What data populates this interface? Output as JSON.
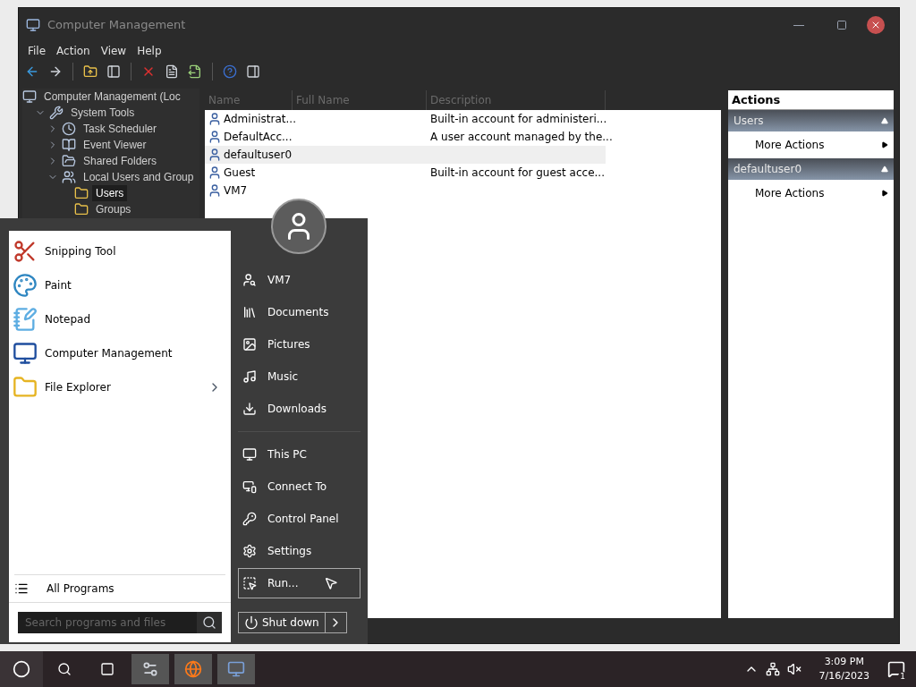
{
  "window": {
    "title": "Computer Management"
  },
  "menu": [
    "File",
    "Action",
    "View",
    "Help"
  ],
  "tree": [
    {
      "label": "Computer Management (Loc",
      "selected": false,
      "children": [
        {
          "label": "System Tools",
          "expanded": true,
          "selected": false,
          "children": [
            {
              "label": "Task Scheduler",
              "expanded": false,
              "selected": false
            },
            {
              "label": "Event Viewer",
              "expanded": false,
              "selected": false
            },
            {
              "label": "Shared Folders",
              "expanded": false,
              "selected": false
            },
            {
              "label": "Local Users and Group",
              "expanded": true,
              "selected": false,
              "children": [
                {
                  "label": "Users",
                  "selected": true
                },
                {
                  "label": "Groups",
                  "selected": false
                }
              ]
            }
          ]
        }
      ]
    }
  ],
  "table": {
    "columns": [
      "Name",
      "Full Name",
      "Description"
    ],
    "rows": [
      {
        "name": "Administrat...",
        "full_name": "",
        "description": "Built-in account for administeri...",
        "selected": false
      },
      {
        "name": "DefaultAcc...",
        "full_name": "",
        "description": "A user account managed by the...",
        "selected": false
      },
      {
        "name": "defaultuser0",
        "full_name": "",
        "description": "",
        "selected": true
      },
      {
        "name": "Guest",
        "full_name": "",
        "description": "Built-in account for guest acce...",
        "selected": false
      },
      {
        "name": "VM7",
        "full_name": "",
        "description": "",
        "selected": false
      }
    ]
  },
  "actions": {
    "title": "Actions",
    "sections": [
      {
        "title": "Users",
        "items": [
          "More Actions"
        ]
      },
      {
        "title": "defaultuser0",
        "items": [
          "More Actions"
        ]
      }
    ]
  },
  "start_menu": {
    "pinned": [
      {
        "label": "Snipping Tool",
        "submenu": false
      },
      {
        "label": "Paint",
        "submenu": false
      },
      {
        "label": "Notepad",
        "submenu": false
      },
      {
        "label": "Computer Management",
        "submenu": false
      },
      {
        "label": "File Explorer",
        "submenu": true
      }
    ],
    "all_programs": "All Programs",
    "search": {
      "placeholder": "Search programs and files"
    },
    "places": [
      [
        {
          "label": "VM7",
          "hovered": false
        },
        {
          "label": "Documents",
          "hovered": false
        },
        {
          "label": "Pictures",
          "hovered": false
        },
        {
          "label": "Music",
          "hovered": false
        },
        {
          "label": "Downloads",
          "hovered": false
        }
      ],
      [
        {
          "label": "This PC",
          "hovered": false
        },
        {
          "label": "Connect To",
          "hovered": false
        },
        {
          "label": "Control Panel",
          "hovered": false
        },
        {
          "label": "Settings",
          "hovered": false
        },
        {
          "label": "Run...",
          "hovered": true
        }
      ]
    ],
    "shutdown": "Shut down"
  },
  "taskbar": {
    "apps": [
      {
        "selected": true
      },
      {
        "selected": true
      },
      {
        "selected": true
      }
    ],
    "time": "3:09 PM",
    "date": "7/16/2023",
    "notifications": "1"
  }
}
